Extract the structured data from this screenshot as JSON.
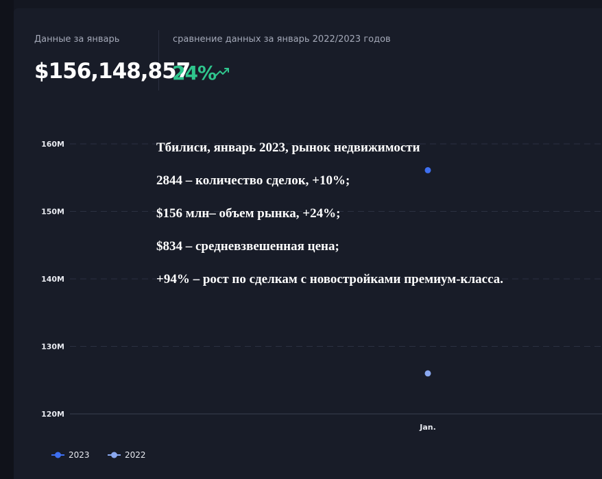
{
  "stats": {
    "january_label": "Данные за январь",
    "january_value": "$156,148,857",
    "comparison_label": "сравнение данных за январь 2022/2023 годов",
    "comparison_value": "24%",
    "trend_icon": "trend-up-icon",
    "trend_color": "#2fc58d"
  },
  "overlay": {
    "line1": "Тбилиси, январь 2023, рынок недвижимости",
    "line2": "2844 – количество сделок, +10%;",
    "line3": "$156 млн– объем рынка, +24%;",
    "line4": "$834 – средневзвешенная цена;",
    "line5": "+94% – рост по сделкам с новостройками премиум-класса."
  },
  "chart_data": {
    "type": "scatter",
    "categories": [
      "Jan."
    ],
    "y_ticks": [
      "160M",
      "150M",
      "140M",
      "130M",
      "120M"
    ],
    "ylim": [
      120,
      160
    ],
    "y_unit": "M",
    "grid": true,
    "legend_position": "bottom-left",
    "series": [
      {
        "name": "2023",
        "color": "#3e6ff0",
        "values": [
          156.1
        ]
      },
      {
        "name": "2022",
        "color": "#8aa8f0",
        "values": [
          126.0
        ]
      }
    ]
  }
}
